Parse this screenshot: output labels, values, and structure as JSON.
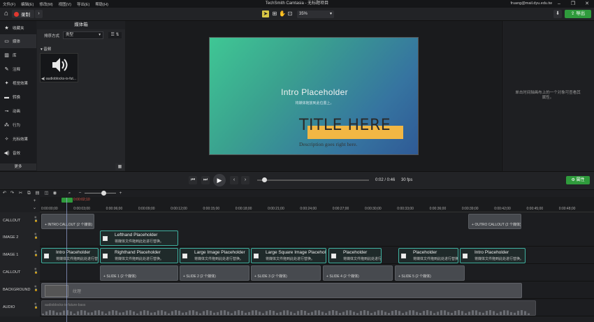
{
  "menu": [
    "文件(F)",
    "编辑(E)",
    "修改(M)",
    "视图(V)",
    "导出(E)",
    "帮助(H)"
  ],
  "window_title": "TechSmith Camtasia - 无标题项目",
  "account_email": "fruang@mail.dyu.edu.tw",
  "toolbar": {
    "record_label": "录制",
    "zoom_value": "35%",
    "export_label": "导出"
  },
  "sidebar": {
    "items": [
      {
        "label": "收藏夹",
        "icon": "star-icon"
      },
      {
        "label": "媒体",
        "icon": "media-icon"
      },
      {
        "label": "库",
        "icon": "library-icon"
      },
      {
        "label": "注释",
        "icon": "annotation-icon"
      },
      {
        "label": "视觉效果",
        "icon": "visual-effects-icon"
      },
      {
        "label": "转换",
        "icon": "transition-icon"
      },
      {
        "label": "动画",
        "icon": "animation-icon"
      },
      {
        "label": "行为",
        "icon": "behavior-icon"
      },
      {
        "label": "光标效果",
        "icon": "cursor-effects-icon"
      },
      {
        "label": "音效",
        "icon": "audio-effects-icon"
      }
    ],
    "more_label": "更多"
  },
  "media_panel": {
    "title": "媒体箱",
    "sort_label": "排序方式",
    "sort_value": "类型",
    "section": "音频",
    "file_name": "audioblocks-is-fut..."
  },
  "canvas": {
    "intro_title": "Intro Placeholder",
    "intro_sub": "将媒体拖放到此位置上。",
    "big_title": "TITLE HERE",
    "description": "Description goes right here."
  },
  "properties_hint": "单击时间轴画布上的一个对象可查看其属性。",
  "playback": {
    "timecode": "0:02 / 0:46",
    "fps": "30 fps",
    "props_button": "属性"
  },
  "timeline": {
    "playhead_time": "0:00:02;10",
    "ticks": [
      "0:00:00;00",
      "0:00:03;00",
      "0:00:06;00",
      "0:00:09;00",
      "0:00:12;00",
      "0:00:15;00",
      "0:00:18;00",
      "0:00:21;00",
      "0:00:24;00",
      "0:00:27;00",
      "0:00:30;00",
      "0:00:33;00",
      "0:00:36;00",
      "0:00:39;00",
      "0:00:42;00",
      "0:00:45;00",
      "0:00:48;00"
    ],
    "tracks": [
      "CALLOUT",
      "IMAGE 2",
      "IMAGE 1",
      "CALLOUT",
      "BACKGROUND",
      "AUDIO"
    ],
    "callout_top": [
      "INTRO CALLOUT",
      "OUTRO CALLOUT"
    ],
    "callout_suffix": "(2 个媒体)",
    "image2": [
      {
        "title": "Lefthand Placeholder",
        "sub": "将媒体文件拖到此处进行替换。"
      }
    ],
    "image1": [
      {
        "title": "Intro Placeholder",
        "sub": "将媒体文件拖到此处进行替换。"
      },
      {
        "title": "Righthand Placeholder",
        "sub": "将媒体文件拖到此处进行替换。"
      },
      {
        "title": "Large Image Placeholder",
        "sub": "将媒体文件拖到此处进行替换。"
      },
      {
        "title": "Large Square Image Placeholder",
        "sub": "将媒体文件拖到此处进行替换。"
      },
      {
        "title": "Placeholder",
        "sub": "将媒体文件拖到此处进行替换。"
      },
      {
        "title": "Placeholder",
        "sub": "将媒体文件拖到此处进行替换。"
      },
      {
        "title": "Intro Placeholder",
        "sub": "将媒体文件拖到此处进行替换。"
      }
    ],
    "slides": [
      "SLIDE 1",
      "SLIDE 2",
      "SLIDE 3",
      "SLIDE 4",
      "SLIDE 5"
    ],
    "background_label": "纹理",
    "audio_label": "audioblocks-is-future-bass"
  }
}
